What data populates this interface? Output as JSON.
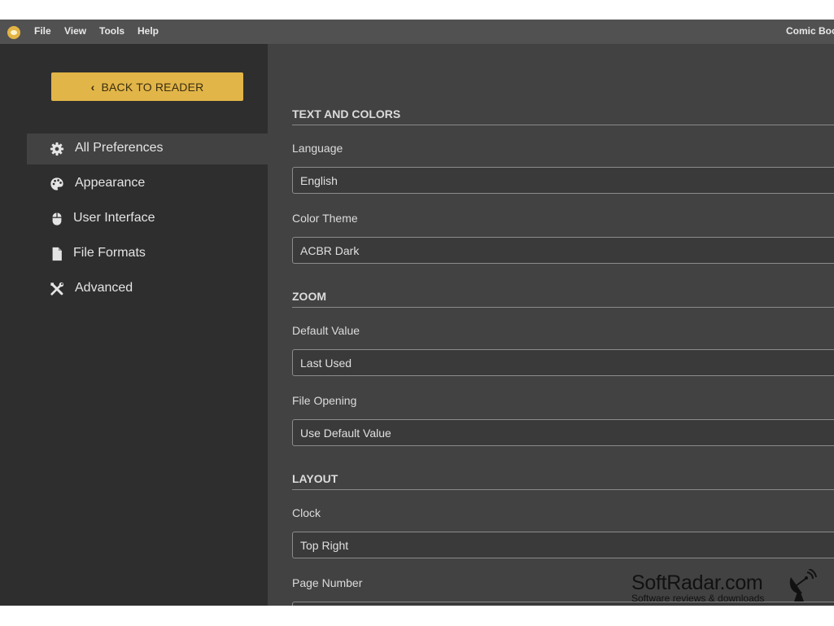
{
  "menubar": {
    "items": [
      "File",
      "View",
      "Tools",
      "Help"
    ],
    "title": "Comic Boo"
  },
  "sidebar": {
    "back_button": "BACK TO READER",
    "items": [
      {
        "label": "All Preferences",
        "icon": "gear-icon",
        "active": true
      },
      {
        "label": "Appearance",
        "icon": "palette-icon",
        "active": false
      },
      {
        "label": "User Interface",
        "icon": "mouse-icon",
        "active": false
      },
      {
        "label": "File Formats",
        "icon": "file-icon",
        "active": false
      },
      {
        "label": "Advanced",
        "icon": "tools-icon",
        "active": false
      }
    ]
  },
  "sections": [
    {
      "title": "TEXT AND COLORS",
      "fields": [
        {
          "label": "Language",
          "value": "English"
        },
        {
          "label": "Color Theme",
          "value": "ACBR Dark"
        }
      ]
    },
    {
      "title": "ZOOM",
      "fields": [
        {
          "label": "Default Value",
          "value": "Last Used"
        },
        {
          "label": "File Opening",
          "value": "Use Default Value"
        }
      ]
    },
    {
      "title": "LAYOUT",
      "fields": [
        {
          "label": "Clock",
          "value": "Top Right"
        },
        {
          "label": "Page Number",
          "value": ""
        }
      ]
    }
  ],
  "watermark": {
    "title": "SoftRadar.com",
    "subtitle": "Software reviews & downloads"
  },
  "colors": {
    "accent": "#e2b548",
    "sidebar_bg": "#2e2e2e",
    "content_bg": "#424242",
    "menubar_bg": "#515151"
  }
}
